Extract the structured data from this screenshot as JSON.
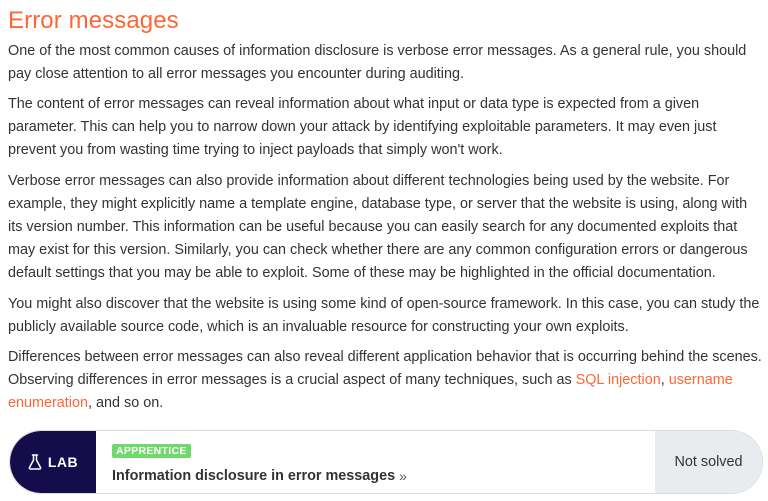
{
  "heading": "Error messages",
  "paragraphs": {
    "p1": "One of the most common causes of information disclosure is verbose error messages. As a general rule, you should pay close attention to all error messages you encounter during auditing.",
    "p2": "The content of error messages can reveal information about what input or data type is expected from a given parameter. This can help you to narrow down your attack by identifying exploitable parameters. It may even just prevent you from wasting time trying to inject payloads that simply won't work.",
    "p3": "Verbose error messages can also provide information about different technologies being used by the website. For example, they might explicitly name a template engine, database type, or server that the website is using, along with its version number. This information can be useful because you can easily search for any documented exploits that may exist for this version. Similarly, you can check whether there are any common configuration errors or dangerous default settings that you may be able to exploit. Some of these may be highlighted in the official documentation.",
    "p4": "You might also discover that the website is using some kind of open-source framework. In this case, you can study the publicly available source code, which is an invaluable resource for constructing your own exploits.",
    "p5_before": "Differences between error messages can also reveal different application behavior that is occurring behind the scenes. Observing differences in error messages is a crucial aspect of many techniques, such as ",
    "p5_link1": "SQL injection",
    "p5_sep": ", ",
    "p5_link2": "username enumeration",
    "p5_after": ", and so on."
  },
  "lab": {
    "badge_label": "LAB",
    "badge_icon": "flask-icon",
    "level": "APPRENTICE",
    "title": "Information disclosure in error messages",
    "chevron": "»",
    "status": "Not solved"
  },
  "colors": {
    "accent": "#ff6633",
    "lab_badge_bg": "#140c4b",
    "level_badge_bg": "#70d96b",
    "status_bg": "#e8ecef"
  }
}
